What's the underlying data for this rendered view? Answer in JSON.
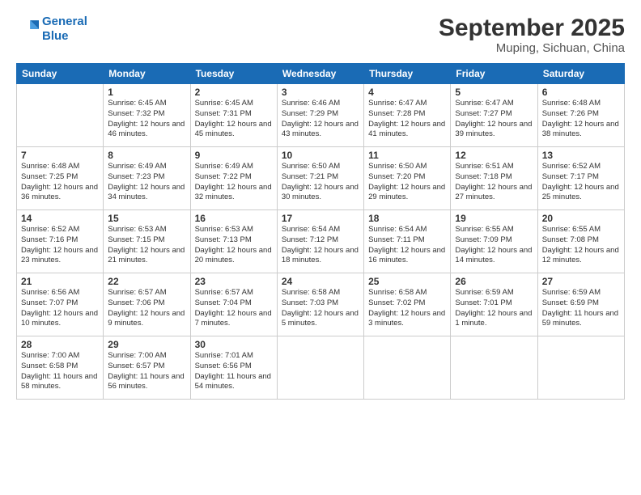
{
  "logo": {
    "line1": "General",
    "line2": "Blue"
  },
  "title": "September 2025",
  "subtitle": "Muping, Sichuan, China",
  "days_of_week": [
    "Sunday",
    "Monday",
    "Tuesday",
    "Wednesday",
    "Thursday",
    "Friday",
    "Saturday"
  ],
  "weeks": [
    [
      {
        "day": "",
        "sunrise": "",
        "sunset": "",
        "daylight": ""
      },
      {
        "day": "1",
        "sunrise": "Sunrise: 6:45 AM",
        "sunset": "Sunset: 7:32 PM",
        "daylight": "Daylight: 12 hours and 46 minutes."
      },
      {
        "day": "2",
        "sunrise": "Sunrise: 6:45 AM",
        "sunset": "Sunset: 7:31 PM",
        "daylight": "Daylight: 12 hours and 45 minutes."
      },
      {
        "day": "3",
        "sunrise": "Sunrise: 6:46 AM",
        "sunset": "Sunset: 7:29 PM",
        "daylight": "Daylight: 12 hours and 43 minutes."
      },
      {
        "day": "4",
        "sunrise": "Sunrise: 6:47 AM",
        "sunset": "Sunset: 7:28 PM",
        "daylight": "Daylight: 12 hours and 41 minutes."
      },
      {
        "day": "5",
        "sunrise": "Sunrise: 6:47 AM",
        "sunset": "Sunset: 7:27 PM",
        "daylight": "Daylight: 12 hours and 39 minutes."
      },
      {
        "day": "6",
        "sunrise": "Sunrise: 6:48 AM",
        "sunset": "Sunset: 7:26 PM",
        "daylight": "Daylight: 12 hours and 38 minutes."
      }
    ],
    [
      {
        "day": "7",
        "sunrise": "Sunrise: 6:48 AM",
        "sunset": "Sunset: 7:25 PM",
        "daylight": "Daylight: 12 hours and 36 minutes."
      },
      {
        "day": "8",
        "sunrise": "Sunrise: 6:49 AM",
        "sunset": "Sunset: 7:23 PM",
        "daylight": "Daylight: 12 hours and 34 minutes."
      },
      {
        "day": "9",
        "sunrise": "Sunrise: 6:49 AM",
        "sunset": "Sunset: 7:22 PM",
        "daylight": "Daylight: 12 hours and 32 minutes."
      },
      {
        "day": "10",
        "sunrise": "Sunrise: 6:50 AM",
        "sunset": "Sunset: 7:21 PM",
        "daylight": "Daylight: 12 hours and 30 minutes."
      },
      {
        "day": "11",
        "sunrise": "Sunrise: 6:50 AM",
        "sunset": "Sunset: 7:20 PM",
        "daylight": "Daylight: 12 hours and 29 minutes."
      },
      {
        "day": "12",
        "sunrise": "Sunrise: 6:51 AM",
        "sunset": "Sunset: 7:18 PM",
        "daylight": "Daylight: 12 hours and 27 minutes."
      },
      {
        "day": "13",
        "sunrise": "Sunrise: 6:52 AM",
        "sunset": "Sunset: 7:17 PM",
        "daylight": "Daylight: 12 hours and 25 minutes."
      }
    ],
    [
      {
        "day": "14",
        "sunrise": "Sunrise: 6:52 AM",
        "sunset": "Sunset: 7:16 PM",
        "daylight": "Daylight: 12 hours and 23 minutes."
      },
      {
        "day": "15",
        "sunrise": "Sunrise: 6:53 AM",
        "sunset": "Sunset: 7:15 PM",
        "daylight": "Daylight: 12 hours and 21 minutes."
      },
      {
        "day": "16",
        "sunrise": "Sunrise: 6:53 AM",
        "sunset": "Sunset: 7:13 PM",
        "daylight": "Daylight: 12 hours and 20 minutes."
      },
      {
        "day": "17",
        "sunrise": "Sunrise: 6:54 AM",
        "sunset": "Sunset: 7:12 PM",
        "daylight": "Daylight: 12 hours and 18 minutes."
      },
      {
        "day": "18",
        "sunrise": "Sunrise: 6:54 AM",
        "sunset": "Sunset: 7:11 PM",
        "daylight": "Daylight: 12 hours and 16 minutes."
      },
      {
        "day": "19",
        "sunrise": "Sunrise: 6:55 AM",
        "sunset": "Sunset: 7:09 PM",
        "daylight": "Daylight: 12 hours and 14 minutes."
      },
      {
        "day": "20",
        "sunrise": "Sunrise: 6:55 AM",
        "sunset": "Sunset: 7:08 PM",
        "daylight": "Daylight: 12 hours and 12 minutes."
      }
    ],
    [
      {
        "day": "21",
        "sunrise": "Sunrise: 6:56 AM",
        "sunset": "Sunset: 7:07 PM",
        "daylight": "Daylight: 12 hours and 10 minutes."
      },
      {
        "day": "22",
        "sunrise": "Sunrise: 6:57 AM",
        "sunset": "Sunset: 7:06 PM",
        "daylight": "Daylight: 12 hours and 9 minutes."
      },
      {
        "day": "23",
        "sunrise": "Sunrise: 6:57 AM",
        "sunset": "Sunset: 7:04 PM",
        "daylight": "Daylight: 12 hours and 7 minutes."
      },
      {
        "day": "24",
        "sunrise": "Sunrise: 6:58 AM",
        "sunset": "Sunset: 7:03 PM",
        "daylight": "Daylight: 12 hours and 5 minutes."
      },
      {
        "day": "25",
        "sunrise": "Sunrise: 6:58 AM",
        "sunset": "Sunset: 7:02 PM",
        "daylight": "Daylight: 12 hours and 3 minutes."
      },
      {
        "day": "26",
        "sunrise": "Sunrise: 6:59 AM",
        "sunset": "Sunset: 7:01 PM",
        "daylight": "Daylight: 12 hours and 1 minute."
      },
      {
        "day": "27",
        "sunrise": "Sunrise: 6:59 AM",
        "sunset": "Sunset: 6:59 PM",
        "daylight": "Daylight: 11 hours and 59 minutes."
      }
    ],
    [
      {
        "day": "28",
        "sunrise": "Sunrise: 7:00 AM",
        "sunset": "Sunset: 6:58 PM",
        "daylight": "Daylight: 11 hours and 58 minutes."
      },
      {
        "day": "29",
        "sunrise": "Sunrise: 7:00 AM",
        "sunset": "Sunset: 6:57 PM",
        "daylight": "Daylight: 11 hours and 56 minutes."
      },
      {
        "day": "30",
        "sunrise": "Sunrise: 7:01 AM",
        "sunset": "Sunset: 6:56 PM",
        "daylight": "Daylight: 11 hours and 54 minutes."
      },
      {
        "day": "",
        "sunrise": "",
        "sunset": "",
        "daylight": ""
      },
      {
        "day": "",
        "sunrise": "",
        "sunset": "",
        "daylight": ""
      },
      {
        "day": "",
        "sunrise": "",
        "sunset": "",
        "daylight": ""
      },
      {
        "day": "",
        "sunrise": "",
        "sunset": "",
        "daylight": ""
      }
    ]
  ]
}
